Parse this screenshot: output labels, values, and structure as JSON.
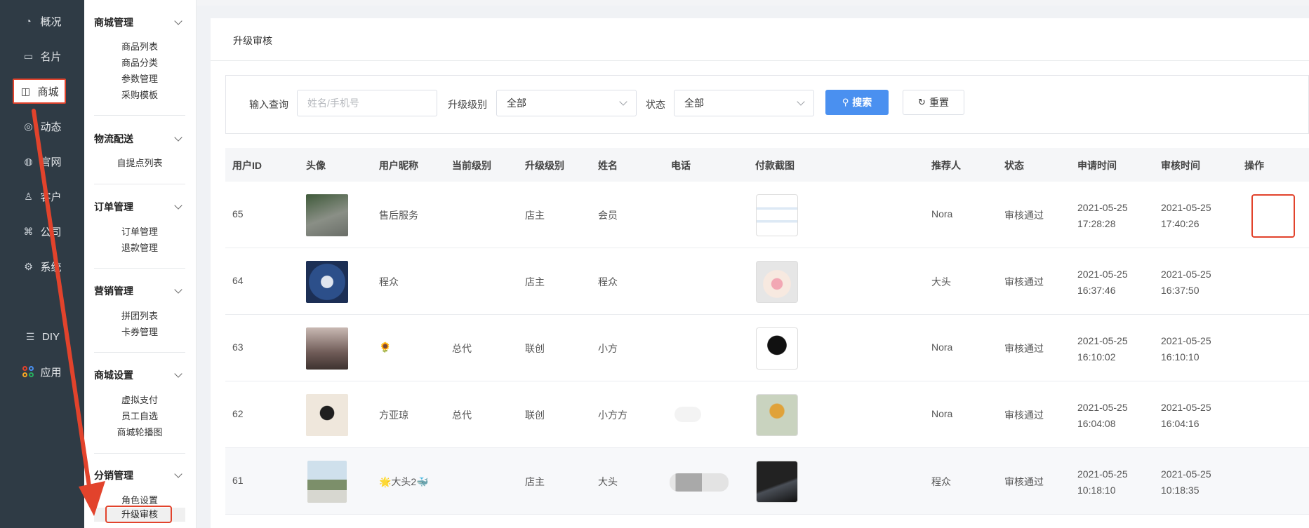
{
  "sidebar": {
    "items": [
      {
        "label": "概况",
        "icon": "pie-chart-icon"
      },
      {
        "label": "名片",
        "icon": "card-icon"
      },
      {
        "label": "商城",
        "icon": "shopping-bag-icon"
      },
      {
        "label": "动态",
        "icon": "compass-icon"
      },
      {
        "label": "官网",
        "icon": "palette-icon"
      },
      {
        "label": "客户",
        "icon": "user-icon"
      },
      {
        "label": "公司",
        "icon": "org-chart-icon"
      },
      {
        "label": "系统",
        "icon": "gear-icon"
      },
      {
        "label": "DIY",
        "icon": "list-icon"
      },
      {
        "label": "应用",
        "icon": "apps-icon"
      }
    ]
  },
  "menu": {
    "groups": [
      {
        "title": "商城管理",
        "items": [
          "商品列表",
          "商品分类",
          "参数管理",
          "采购模板"
        ]
      },
      {
        "title": "物流配送",
        "items": [
          "自提点列表"
        ]
      },
      {
        "title": "订单管理",
        "items": [
          "订单管理",
          "退款管理"
        ]
      },
      {
        "title": "营销管理",
        "items": [
          "拼团列表",
          "卡券管理"
        ]
      },
      {
        "title": "商城设置",
        "items": [
          "虚拟支付",
          "员工自选",
          "商城轮播图"
        ]
      },
      {
        "title": "分销管理",
        "items": [
          "角色设置",
          "升级审核"
        ]
      }
    ]
  },
  "page": {
    "title": "升级审核"
  },
  "search": {
    "query_label": "输入查询",
    "query_placeholder": "姓名/手机号",
    "level_label": "升级级别",
    "level_value": "全部",
    "status_label": "状态",
    "status_value": "全部",
    "search_button": "搜索",
    "reset_button": "重置"
  },
  "table": {
    "headers": [
      "用户ID",
      "头像",
      "用户昵称",
      "当前级别",
      "升级级别",
      "姓名",
      "电话",
      "付款截图",
      "推荐人",
      "状态",
      "申请时间",
      "审核时间",
      "操作"
    ],
    "rows": [
      {
        "id": "65",
        "nickname": "售后服务",
        "current": "",
        "upgrade": "店主",
        "name": "会员",
        "phone": "",
        "referrer": "Nora",
        "status": "审核通过",
        "apply_date": "2021-05-25",
        "apply_time": "17:28:28",
        "audit_date": "2021-05-25",
        "audit_time": "17:40:26"
      },
      {
        "id": "64",
        "nickname": "程众",
        "current": "",
        "upgrade": "店主",
        "name": "程众",
        "phone": "",
        "referrer": "大头",
        "status": "审核通过",
        "apply_date": "2021-05-25",
        "apply_time": "16:37:46",
        "audit_date": "2021-05-25",
        "audit_time": "16:37:50"
      },
      {
        "id": "63",
        "nickname": "🌻",
        "current": "总代",
        "upgrade": "联创",
        "name": "小方",
        "phone": "",
        "referrer": "Nora",
        "status": "审核通过",
        "apply_date": "2021-05-25",
        "apply_time": "16:10:02",
        "audit_date": "2021-05-25",
        "audit_time": "16:10:10"
      },
      {
        "id": "62",
        "nickname": "方亚琼",
        "current": "总代",
        "upgrade": "联创",
        "name": "小方方",
        "phone": "",
        "referrer": "Nora",
        "status": "审核通过",
        "apply_date": "2021-05-25",
        "apply_time": "16:04:08",
        "audit_date": "2021-05-25",
        "audit_time": "16:04:16"
      },
      {
        "id": "61",
        "nickname": "🌟大头2🐳",
        "current": "",
        "upgrade": "店主",
        "name": "大头",
        "phone": "",
        "referrer": "程众",
        "status": "审核通过",
        "apply_date": "2021-05-25",
        "apply_time": "10:18:10",
        "audit_date": "2021-05-25",
        "audit_time": "10:18:35"
      }
    ]
  },
  "colors": {
    "accent": "#4a90f0",
    "highlight": "#e2432c",
    "sidebar": "#2f3b45"
  }
}
